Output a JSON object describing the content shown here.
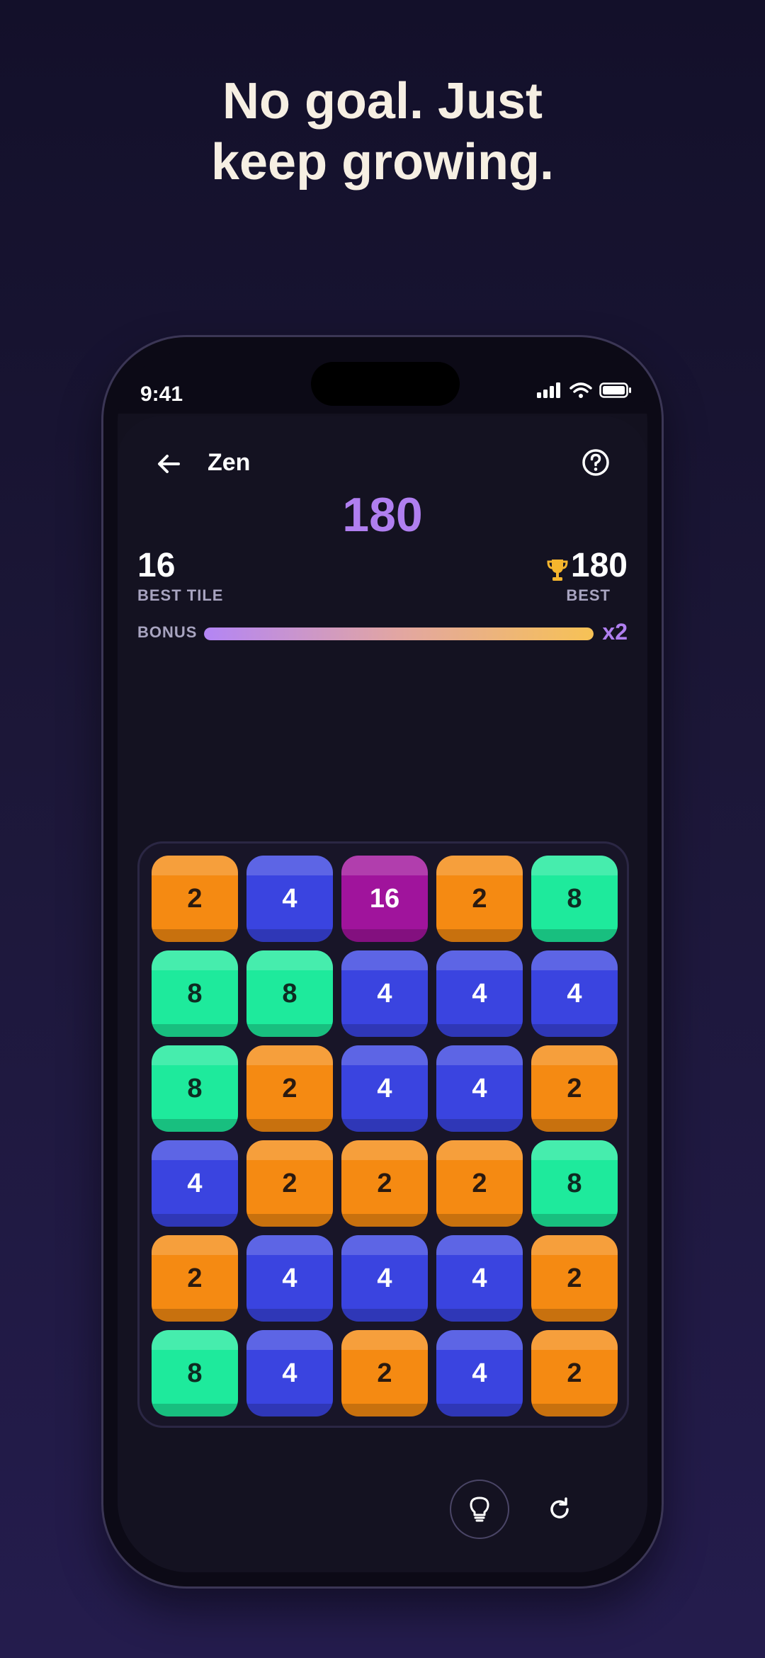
{
  "headline": {
    "line1": "No goal. Just",
    "line2": "keep growing."
  },
  "status_bar": {
    "time": "9:41",
    "icons": [
      "signal-icon",
      "wifi-icon",
      "battery-icon"
    ]
  },
  "header": {
    "title": "Zen",
    "back_icon": "arrow-left-icon",
    "help_icon": "help-circle-icon"
  },
  "score": {
    "current": "180"
  },
  "best_tile": {
    "value": "16",
    "label": "BEST TILE"
  },
  "best": {
    "value": "180",
    "label": "BEST",
    "icon": "trophy-icon"
  },
  "bonus": {
    "label": "BONUS",
    "multiplier": "x2",
    "progress": 1.0
  },
  "board": {
    "rows": [
      [
        "2",
        "4",
        "16",
        "2",
        "8"
      ],
      [
        "8",
        "8",
        "4",
        "4",
        "4"
      ],
      [
        "8",
        "2",
        "4",
        "4",
        "2"
      ],
      [
        "4",
        "2",
        "2",
        "2",
        "8"
      ],
      [
        "2",
        "4",
        "4",
        "4",
        "2"
      ],
      [
        "8",
        "4",
        "2",
        "4",
        "2"
      ]
    ],
    "tile_colors": {
      "2": "#f58a12",
      "4": "#3a44e0",
      "8": "#1eea9c",
      "16": "#a0149c"
    }
  },
  "controls": {
    "hint_icon": "lightbulb-icon",
    "restart_icon": "refresh-icon"
  },
  "colors": {
    "accent": "#b07ff0",
    "background": "#13111f",
    "headline": "#f6efe3",
    "trophy": "#f5b52e"
  }
}
